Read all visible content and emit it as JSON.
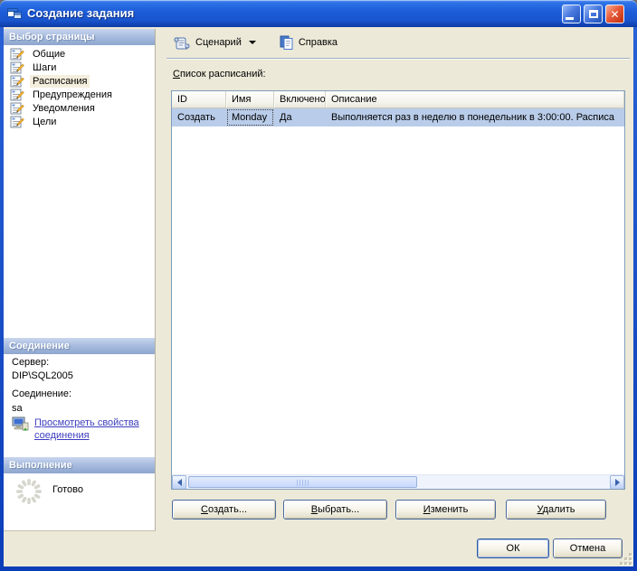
{
  "colors": {
    "titlebar_blue": "#1C5CD8",
    "window_border_blue": "#0B3EB8",
    "content_beige": "#ECE9D8",
    "selection_blue": "#B9CCE9",
    "selected_page_cream": "#F4EEDD",
    "link_blue": "#3C3CC0",
    "panel_header_top": "#C9D5EE",
    "panel_header_bottom": "#8EA6CE"
  },
  "window": {
    "title": "Создание задания",
    "icon": "form-window-icon",
    "controls": {
      "minimize": "minimize-icon",
      "maximize": "maximize-icon",
      "close": "close-icon"
    }
  },
  "sidebar": {
    "pages": {
      "header": "Выбор страницы",
      "item_icon": "page-pencil-icon",
      "items": [
        {
          "label": "Общие",
          "selected": false
        },
        {
          "label": "Шаги",
          "selected": false
        },
        {
          "label": "Расписания",
          "selected": true
        },
        {
          "label": "Предупреждения",
          "selected": false
        },
        {
          "label": "Уведомления",
          "selected": false
        },
        {
          "label": "Цели",
          "selected": false
        }
      ]
    },
    "connection": {
      "header": "Соединение",
      "server_label": "Сервер:",
      "server_value": "DIP\\SQL2005",
      "connection_label": "Соединение:",
      "connection_value": "sa",
      "link_icon": "connection-properties-icon",
      "link_label": "Просмотреть свойства соединения"
    },
    "progress": {
      "header": "Выполнение",
      "icon": "progress-spinner-icon",
      "status": "Готово"
    }
  },
  "toolbar": {
    "script_icon": "script-scroll-icon",
    "script_button": "Сценарий",
    "dropdown_icon": "chevron-down-icon",
    "help_icon": "help-doc-icon",
    "help_button": "Справка"
  },
  "main": {
    "list_label": "Список расписаний:",
    "table": {
      "columns": [
        "ID",
        "Имя",
        "Включено",
        "Описание"
      ],
      "rows": [
        {
          "id": "Создать",
          "name": "Monday",
          "enabled": "Да",
          "description": "Выполняется раз в неделю в понедельник в 3:00:00. Расписа"
        }
      ]
    },
    "scrollbar": {
      "orientation": "horizontal"
    },
    "buttons": {
      "create": "Создать...",
      "pick": "Выбрать...",
      "edit": "Изменить",
      "remove": "Удалить"
    }
  },
  "footer": {
    "ok": "ОК",
    "cancel": "Отмена"
  }
}
